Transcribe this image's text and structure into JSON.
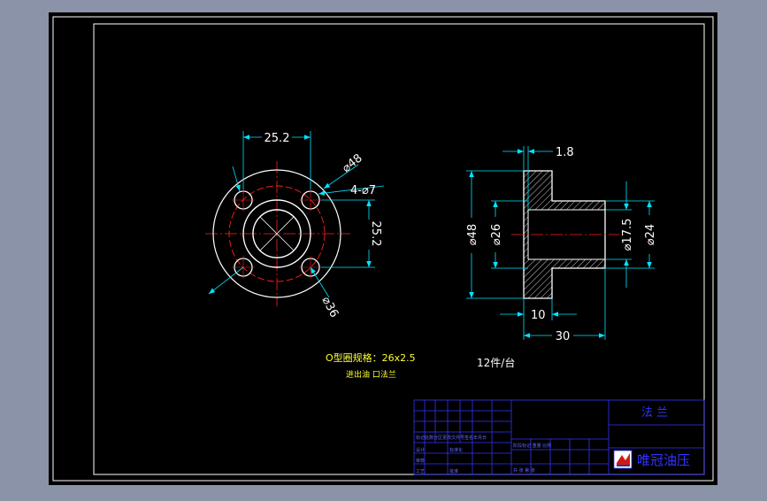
{
  "colors": {
    "background": "#8a93a8",
    "paper": "#000000",
    "border": "#ffffff",
    "part": "#ffffff",
    "centerline": "#ff2020",
    "dimension": "#00e5ff",
    "note": "#ffff33",
    "title_block": "#3333ff"
  },
  "front_view": {
    "dim_width": "25.2",
    "dim_height": "25.2",
    "dia_outer": "⌀48",
    "holes": "4-⌀7",
    "dia_pcd": "⌀36"
  },
  "side_view": {
    "dim_flange_step": "1.8",
    "dia_outer": "⌀48",
    "dia_bore": "⌀26",
    "dia_hub_inner": "⌀17.5",
    "dia_hub_outer": "⌀24",
    "dim_flange_thk": "10",
    "dim_length": "30"
  },
  "notes": {
    "oring_spec": "O型圈规格：26x2.5",
    "port_desc": "进出油 口法兰",
    "qty": "12件/台"
  },
  "title_block": {
    "part_name": "法 兰",
    "company": "唯冠油压",
    "logo_icon": "company-logo-icon"
  }
}
